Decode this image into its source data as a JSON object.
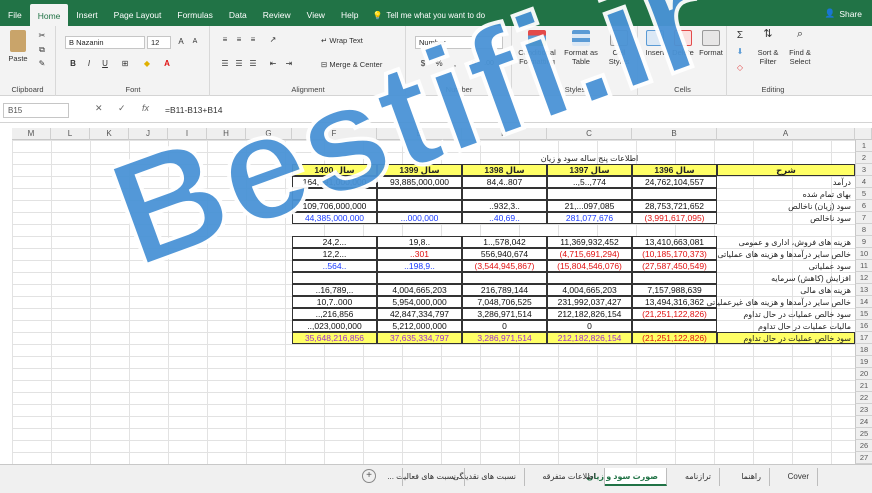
{
  "tabs": [
    "File",
    "Home",
    "Insert",
    "Page Layout",
    "Formulas",
    "Data",
    "Review",
    "View",
    "Help"
  ],
  "active_tab": "Home",
  "tell_me": "Tell me what you want to do",
  "share": "Share",
  "ribbon": {
    "clipboard": {
      "paste": "Paste",
      "label": "Clipboard"
    },
    "font": {
      "name": "B Nazanin",
      "size": "12",
      "label": "Font",
      "bold": "B",
      "italic": "I",
      "underline": "U"
    },
    "alignment": {
      "wrap": "Wrap Text",
      "merge": "Merge & Center",
      "label": "Alignment"
    },
    "number": {
      "format": "Number",
      "label": "Number"
    },
    "styles": {
      "conditional": "Conditional Formatting",
      "format_table": "Format as Table",
      "cell": "Cell Styles",
      "label": "Styles"
    },
    "cells": {
      "insert": "Insert",
      "delete": "Delete",
      "format": "Format",
      "label": "Cells"
    },
    "editing": {
      "sort": "Sort & Filter",
      "find": "Find & Select",
      "label": "Editing"
    }
  },
  "formula_bar": {
    "name_box": "B15",
    "formula": "=B11-B13+B14"
  },
  "columns": [
    "M",
    "L",
    "K",
    "J",
    "I",
    "H",
    "G",
    "F",
    "E",
    "D",
    "C",
    "B",
    "A"
  ],
  "rows": [
    "1",
    "2",
    "3",
    "4",
    "5",
    "6",
    "7",
    "8",
    "9",
    "10",
    "11",
    "12",
    "13",
    "14",
    "15",
    "16",
    "17",
    "18",
    "19",
    "20",
    "21",
    "22",
    "23",
    "24",
    "25",
    "26",
    "27"
  ],
  "sheet": {
    "title": "اطلاعات پنج ساله سود و زیان",
    "headers": [
      "سال 1400",
      "سال 1399",
      "سال 1398",
      "سال 1397",
      "سال 1396",
      "شرح"
    ],
    "data_rows": [
      {
        "row": 4,
        "values": [
          "164,091,000,000",
          "93,885,000,000",
          "84,4..807",
          "..,5..,774",
          "24,762,104,557"
        ],
        "colors": [
          "black",
          "black",
          "black",
          "black",
          "black"
        ],
        "label": "درآمد"
      },
      {
        "row": 5,
        "values": [
          "",
          "",
          "",
          "",
          ""
        ],
        "colors": [
          "black",
          "black",
          "black",
          "black",
          "black"
        ],
        "label": "بهای تمام شده"
      },
      {
        "row": 6,
        "values": [
          "109,706,000,000",
          "",
          "..932,3..",
          "21,...097,085",
          "28,753,721,652"
        ],
        "colors": [
          "black",
          "black",
          "black",
          "black",
          "black"
        ],
        "label": "سود (زیان) ناخالص"
      },
      {
        "row": 7,
        "values": [
          "44,385,000,000",
          "...000,000",
          "..40,69..",
          "281,077,676",
          "(3,991,617,095)"
        ],
        "colors": [
          "blue",
          "blue",
          "blue",
          "blue",
          "red"
        ],
        "label": "سود ناخالص"
      },
      {
        "row": 9,
        "values": [
          "24,2...",
          "19,8..",
          "1..,578,042",
          "11,369,932,452",
          "13,410,663,081"
        ],
        "colors": [
          "black",
          "black",
          "black",
          "black",
          "black"
        ],
        "label": "هزینه های فروش، اداری و عمومی"
      },
      {
        "row": 10,
        "values": [
          "12,2...",
          "..301",
          "556,940,674",
          "(4,715,691,294)",
          "(10,185,170,373)"
        ],
        "colors": [
          "black",
          "red",
          "black",
          "red",
          "red"
        ],
        "label": "خالص سایر درآمدها و هزینه های عملیاتی"
      },
      {
        "row": 11,
        "values": [
          "..564..",
          "..198,9..",
          "(3,544,945,867)",
          "(15,804,546,076)",
          "(27,587,450,549)"
        ],
        "colors": [
          "blue",
          "blue",
          "red",
          "red",
          "red"
        ],
        "label": "سود عملیاتی"
      },
      {
        "row": 12,
        "values": [
          "",
          "",
          "",
          "",
          ""
        ],
        "colors": [
          "black",
          "black",
          "black",
          "black",
          "black"
        ],
        "label": "افزایش (کاهش) سرمایه"
      },
      {
        "row": 13,
        "values": [
          "..16,789,..",
          "4,004,665,203",
          "216,789,144",
          "4,004,665,203",
          "7,157,988,639"
        ],
        "colors": [
          "black",
          "black",
          "black",
          "black",
          "black"
        ],
        "label": "هزینه های مالی"
      },
      {
        "row": 14,
        "values": [
          "10,7..000",
          "5,954,000,000",
          "7,048,706,525",
          "231,992,037,427",
          "13,494,316,362"
        ],
        "colors": [
          "black",
          "black",
          "black",
          "black",
          "black"
        ],
        "label": "خالص سایر درآمدها و هزینه های غیرعملیاتی"
      },
      {
        "row": 15,
        "values": [
          "..,216,856",
          "42,847,334,797",
          "3,286,971,514",
          "212,182,826,154",
          "(21,251,122,826)"
        ],
        "colors": [
          "black",
          "black",
          "black",
          "black",
          "red"
        ],
        "label": "سود خالص عملیات در حال تداوم"
      },
      {
        "row": 16,
        "values": [
          "..,023,000,000",
          "5,212,000,000",
          "0",
          "0",
          ""
        ],
        "colors": [
          "black",
          "black",
          "black",
          "black",
          "black"
        ],
        "label": "مالیات عملیات در حال تداوم"
      },
      {
        "row": 17,
        "values": [
          "35,648,216,856",
          "37,635,334,797",
          "3,286,971,514",
          "212,182,826,154",
          "(21,251,122,826)"
        ],
        "colors": [
          "purple",
          "purple",
          "purple",
          "purple",
          "red"
        ],
        "label": "سود خالص عملیات در حال تداوم"
      }
    ]
  },
  "sheet_tabs": [
    "Cover",
    "راهنما",
    "ترازنامه",
    "صورت سود و زیان",
    "اطلاعات متفرقه",
    "نسبت های نقدینگی",
    "نسبت های فعالیت",
    "..."
  ],
  "active_sheet": "صورت سود و زیان",
  "watermark": "Bestifi.ir",
  "colors": {
    "excel_green": "#217346",
    "header_yellow": "#ffff66",
    "blue": "#1a3bff",
    "red": "#e01010",
    "purple": "#9b2fd0",
    "watermark": "#4a93d6"
  }
}
